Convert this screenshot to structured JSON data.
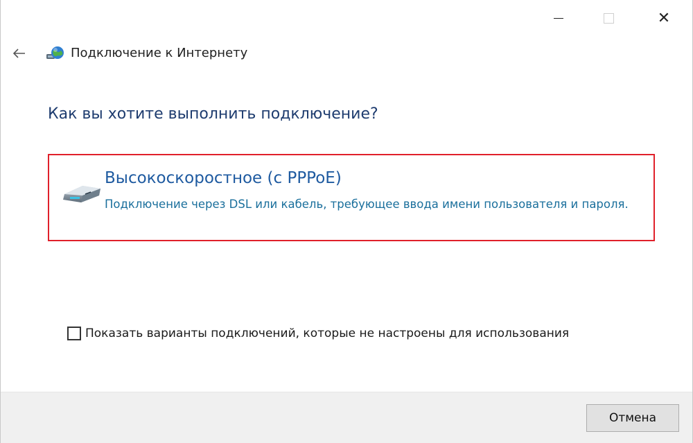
{
  "window": {
    "title": "Подключение к Интернету",
    "controls": {
      "minimize_icon": "minimize-icon",
      "maximize_icon": "maximize-icon",
      "close_icon": "close-icon",
      "close_glyph": "✕"
    }
  },
  "nav": {
    "back_icon": "back-arrow-icon",
    "app_icon": "globe-network-icon"
  },
  "main": {
    "heading": "Как вы хотите выполнить подключение?",
    "options": [
      {
        "icon": "broadband-modem-icon",
        "title": "Высокоскоростное (с PPPoE)",
        "description": "Подключение через DSL или кабель, требующее ввода имени пользователя и пароля.",
        "highlighted": true,
        "highlight_color": "#e0202a"
      }
    ],
    "show_all_checkbox": {
      "label": "Показать варианты подключений, которые не настроены для использования",
      "checked": false
    }
  },
  "footer": {
    "cancel_label": "Отмена"
  },
  "colors": {
    "heading": "#1e3c6f",
    "option_title": "#1e5aa0",
    "option_desc": "#1a6f9c",
    "footer_bg": "#f0f0f0"
  }
}
